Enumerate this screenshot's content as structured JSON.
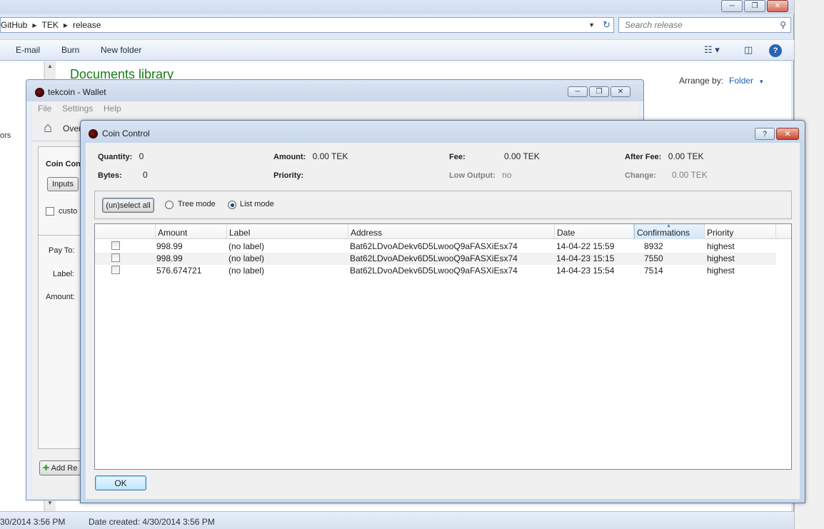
{
  "explorer": {
    "breadcrumbs": [
      "GitHub",
      "TEK",
      "release"
    ],
    "search_placeholder": "Search release",
    "commands": [
      "E-mail",
      "Burn",
      "New folder"
    ],
    "library_title": "Documents library",
    "arrange_label": "Arrange by:",
    "arrange_value": "Folder",
    "nav_fragment": "ors",
    "status_modified": "30/2014 3:56 PM",
    "status_created": "Date created: 4/30/2014 3:56 PM"
  },
  "wallet": {
    "title": "tekcoin - Wallet",
    "menu": [
      "File",
      "Settings",
      "Help"
    ],
    "toolbar_overview": "Over",
    "coin_control_label": "Coin Con",
    "inputs_button": "Inputs",
    "custom_label": "custo",
    "pay_to_label": "Pay To:",
    "label_label": "Label:",
    "amount_label": "Amount:",
    "add_recipient": "Add Re"
  },
  "dialog": {
    "title": "Coin Control",
    "help_glyph": "?",
    "stats": {
      "quantity_label": "Quantity:",
      "quantity": "0",
      "bytes_label": "Bytes:",
      "bytes": "0",
      "amount_label": "Amount:",
      "amount": "0.00 TEK",
      "priority_label": "Priority:",
      "priority": "",
      "fee_label": "Fee:",
      "fee": "0.00 TEK",
      "low_output_label": "Low Output:",
      "low_output": "no",
      "after_fee_label": "After Fee:",
      "after_fee": "0.00 TEK",
      "change_label": "Change:",
      "change": "0.00 TEK"
    },
    "select_all_button": "(un)select all",
    "tree_mode_label": "Tree mode",
    "list_mode_label": "List mode",
    "selected_mode": "list",
    "columns": [
      "Amount",
      "Label",
      "Address",
      "Date",
      "Confirmations",
      "Priority"
    ],
    "sorted_column": "Confirmations",
    "rows": [
      {
        "amount": "998.99",
        "label": "(no label)",
        "address": "Bat62LDvoADekv6D5LwooQ9aFASXiEsx74",
        "date": "14-04-22 15:59",
        "confirmations": "8932",
        "priority": "highest"
      },
      {
        "amount": "998.99",
        "label": "(no label)",
        "address": "Bat62LDvoADekv6D5LwooQ9aFASXiEsx74",
        "date": "14-04-23 15:15",
        "confirmations": "7550",
        "priority": "highest"
      },
      {
        "amount": "576.674721",
        "label": "(no label)",
        "address": "Bat62LDvoADekv6D5LwooQ9aFASXiEsx74",
        "date": "14-04-23 15:54",
        "confirmations": "7514",
        "priority": "highest"
      }
    ],
    "ok_button": "OK"
  },
  "colors": {
    "library_title": "#1a7a1a",
    "link_blue": "#1f5fb8",
    "disabled_text": "#808080"
  }
}
